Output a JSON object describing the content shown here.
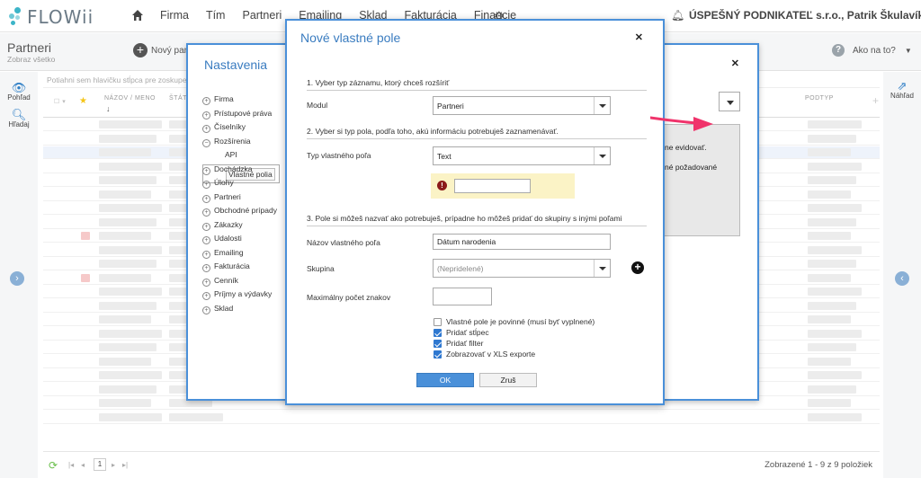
{
  "app": {
    "logo": "FLOWii"
  },
  "nav": {
    "items": [
      "Firma",
      "Tím",
      "Partneri",
      "Emailing",
      "Sklad",
      "Fakturácia",
      "Financie"
    ]
  },
  "account": {
    "company": "ÚSPEŠNÝ PODNIKATEĽ s.r.o., Patrik Škulavík"
  },
  "page": {
    "title": "Partneri",
    "subtitle": "Zobraz všetko",
    "new_button": "Nový part",
    "help": "Ako na to?"
  },
  "left_sidebar": {
    "view_label": "Pohľad",
    "search_label": "Hľadaj"
  },
  "right_sidebar": {
    "preview_label": "Náhľad"
  },
  "table": {
    "group_hint": "Potiahni sem hlavičku stĺpca pre zoskupe",
    "col_name": "NÁZOV / MENO",
    "col_state": "ŠTÁT",
    "col_subtype": "PODTYP",
    "footer_page": "1",
    "footer_count": "Zobrazené 1 - 9 z 9 položiek"
  },
  "settings_modal": {
    "title": "Nastavenia",
    "tree": [
      {
        "label": "Firma",
        "sign": "+"
      },
      {
        "label": "Prístupové práva",
        "sign": "+"
      },
      {
        "label": "Číselníky",
        "sign": "+"
      },
      {
        "label": "Rozšírenia",
        "sign": "−"
      },
      {
        "label": "API",
        "sub": true
      },
      {
        "label": "Vlastné polia",
        "sub": true,
        "selected": true
      },
      {
        "label": "Dochádzka",
        "sign": "+"
      },
      {
        "label": "Úlohy",
        "sign": "+"
      },
      {
        "label": "Partneri",
        "sign": "+"
      },
      {
        "label": "Obchodné prípady",
        "sign": "+"
      },
      {
        "label": "Zákazky",
        "sign": "+"
      },
      {
        "label": "Udalosti",
        "sign": "+"
      },
      {
        "label": "Emailing",
        "sign": "+"
      },
      {
        "label": "Fakturácia",
        "sign": "+"
      },
      {
        "label": "Cenník",
        "sign": "+"
      },
      {
        "label": "Príjmy a výdavky",
        "sign": "+"
      },
      {
        "label": "Sklad",
        "sign": "+"
      }
    ],
    "panel_text_1": "ne evidovať.",
    "panel_text_2": "né požadované"
  },
  "newfield_modal": {
    "title": "Nové vlastné pole",
    "section1": "1. Vyber typ záznamu, ktorý chceš rozšíriť",
    "module_label": "Modul",
    "module_value": "Partneri",
    "section2": "2. Vyber si typ pola, podľa toho, akú informáciu potrebuješ zaznamenávať.",
    "type_label": "Typ vlastného poľa",
    "type_value": "Text",
    "warning_icon": "!",
    "section3": "3. Pole si môžeš nazvať ako potrebuješ, prípadne ho môžeš pridať do skupiny s inými poľami",
    "name_label": "Názov vlastného poľa",
    "name_value": "Dátum narodenia",
    "group_label": "Skupina",
    "group_value": "(Nepridelené)",
    "maxchars_label": "Maximálny počet znakov",
    "maxchars_value": "",
    "checkboxes": [
      {
        "label": "Vlastné pole je povinné (musí byť vyplnené)",
        "checked": false
      },
      {
        "label": "Pridať stĺpec",
        "checked": true
      },
      {
        "label": "Pridať filter",
        "checked": true
      },
      {
        "label": "Zobrazovať v XLS exporte",
        "checked": true
      }
    ],
    "ok_label": "OK",
    "cancel_label": "Zruš"
  },
  "colors": {
    "accent": "#4a90d9",
    "arrow": "#f0336b",
    "warning_bg": "#fbf3c6"
  }
}
